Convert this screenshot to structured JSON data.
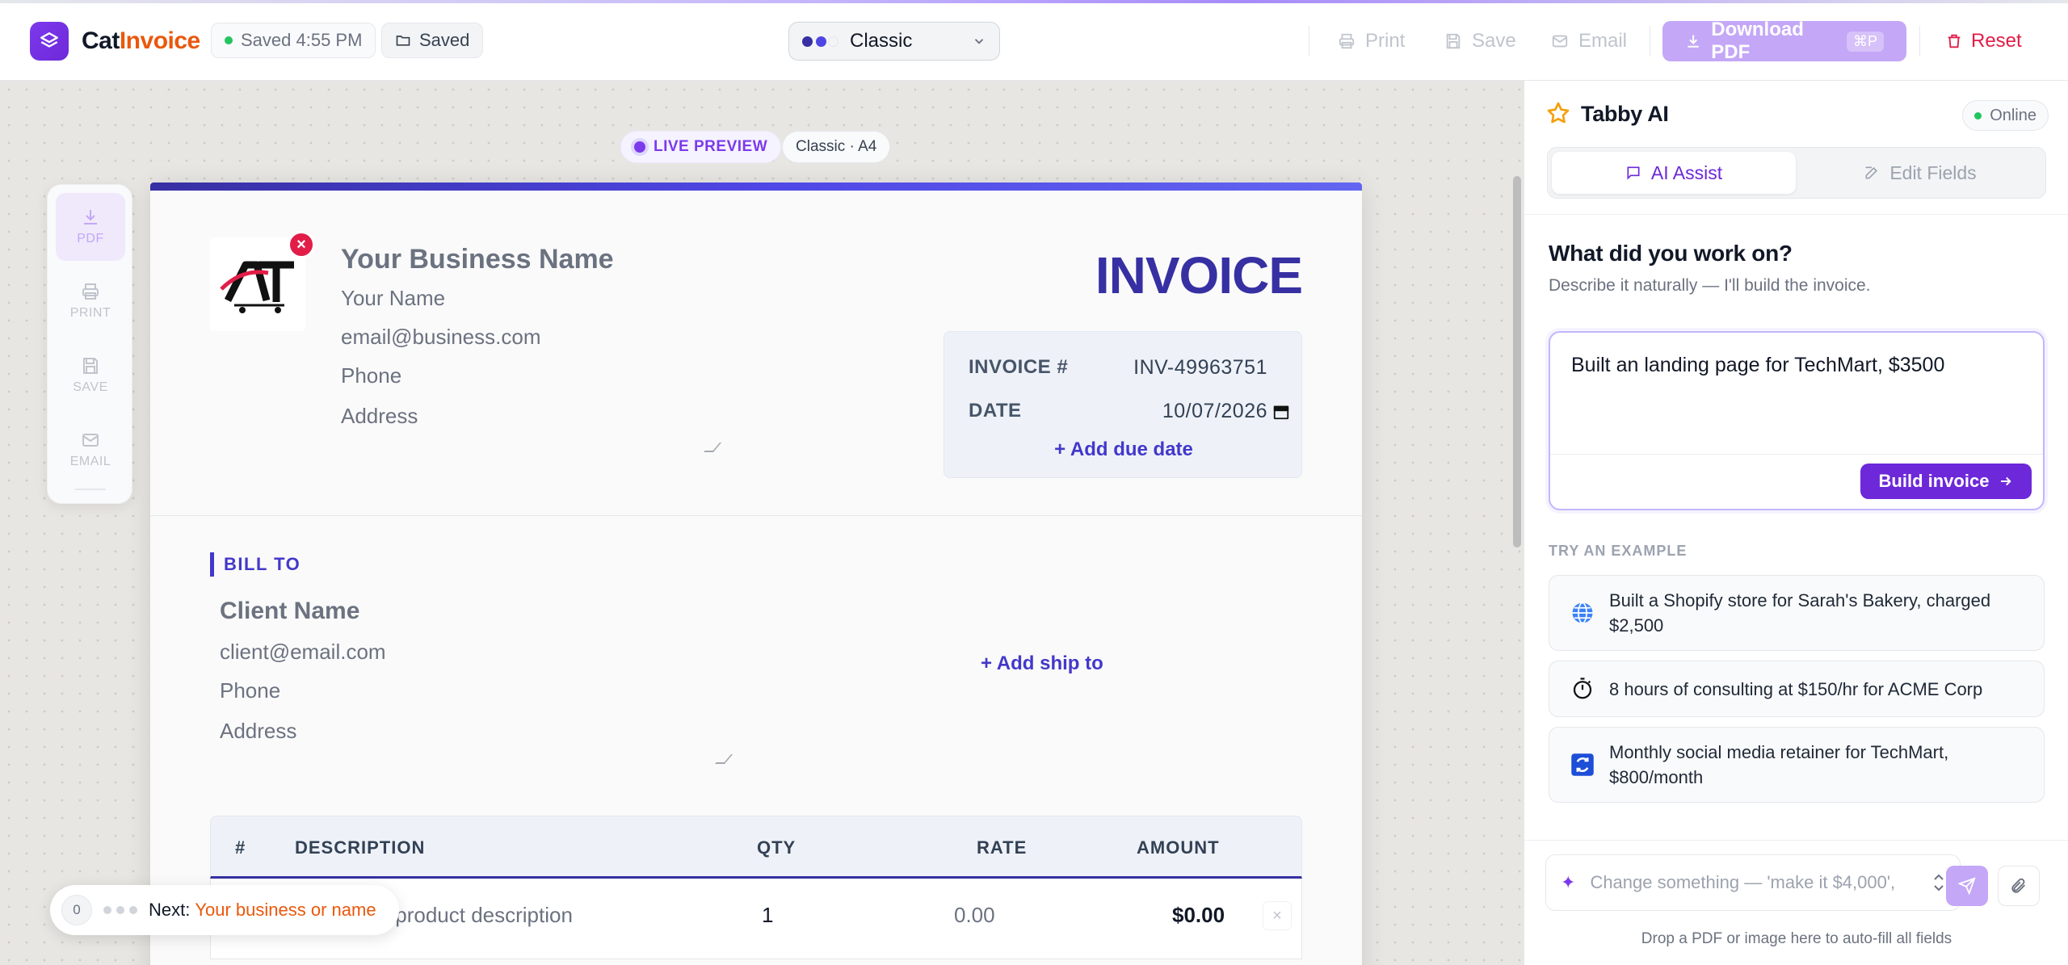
{
  "header": {
    "brand_cat": "Cat",
    "brand_invoice": "Invoice",
    "saved_status": "Saved 4:55 PM",
    "saved_button": "Saved",
    "template": "Classic",
    "print": "Print",
    "save": "Save",
    "email": "Email",
    "download": "Download PDF",
    "download_shortcut": "⌘P",
    "reset": "Reset"
  },
  "preview": {
    "live_badge": "LIVE PREVIEW",
    "size_badge": "Classic · A4"
  },
  "side_tools": [
    {
      "label": "PDF",
      "icon": "download-icon"
    },
    {
      "label": "PRINT",
      "icon": "printer-icon"
    },
    {
      "label": "SAVE",
      "icon": "save-icon"
    },
    {
      "label": "EMAIL",
      "icon": "mail-icon"
    }
  ],
  "invoice": {
    "logo_text": "AT",
    "business_name": "Your Business Name",
    "your_name": "Your Name",
    "email": "email@business.com",
    "phone": "Phone",
    "address": "Address",
    "title": "INVOICE",
    "number_label": "INVOICE #",
    "number_value": "INV-49963751",
    "date_label": "DATE",
    "date_value": "10/07/2026",
    "add_due_date": "+ Add due date",
    "bill_to": "BILL TO",
    "client_name": "Client Name",
    "client_email": "client@email.com",
    "client_phone": "Phone",
    "client_address": "Address",
    "add_ship_to": "+ Add ship to",
    "table_headers": [
      "#",
      "DESCRIPTION",
      "QTY",
      "RATE",
      "AMOUNT"
    ],
    "rows": [
      {
        "description": "Service or product description",
        "qty": "1",
        "rate": "0.00",
        "amount": "$0.00"
      }
    ]
  },
  "next_hint": {
    "count": "0",
    "label": "Next:",
    "value": "Your business or name"
  },
  "panel": {
    "title": "Tabby AI",
    "status": "Online",
    "tab_ai": "AI Assist",
    "tab_edit": "Edit Fields",
    "question": "What did you work on?",
    "subtitle": "Describe it naturally — I'll build the invoice.",
    "prompt_value": "Built an landing page for TechMart, $3500",
    "build_button": "Build invoice",
    "try_label": "TRY AN EXAMPLE",
    "examples": [
      {
        "icon": "globe-icon",
        "text": "Built a Shopify store for Sarah's Bakery, charged $2,500"
      },
      {
        "icon": "stopwatch-icon",
        "text": "8 hours of consulting at $150/hr for ACME Corp"
      },
      {
        "icon": "repeat-icon",
        "text": "Monthly social media retainer for TechMart, $800/month"
      }
    ],
    "chat_placeholder": "Change something — 'make it $4,000', ",
    "drop_hint": "Drop a PDF or image here to auto-fill all fields"
  },
  "colors": {
    "brand_purple": "#6d28d9",
    "accent_orange": "#ea580c",
    "invoice_indigo": "#3730a3",
    "reset_red": "#e11d48",
    "online_green": "#22c55e"
  }
}
